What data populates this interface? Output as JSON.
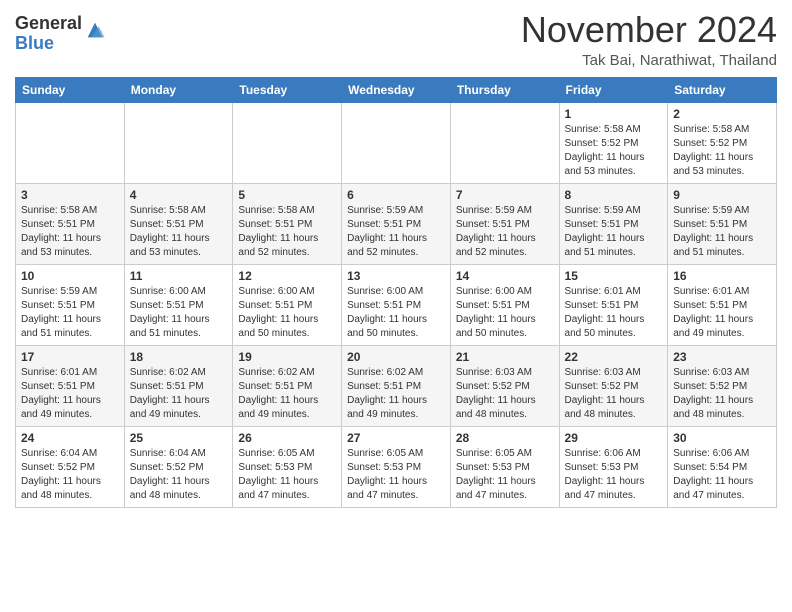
{
  "logo": {
    "general": "General",
    "blue": "Blue"
  },
  "header": {
    "month": "November 2024",
    "location": "Tak Bai, Narathiwat, Thailand"
  },
  "weekdays": [
    "Sunday",
    "Monday",
    "Tuesday",
    "Wednesday",
    "Thursday",
    "Friday",
    "Saturday"
  ],
  "weeks": [
    [
      {
        "day": "",
        "sunrise": "",
        "sunset": "",
        "daylight": ""
      },
      {
        "day": "",
        "sunrise": "",
        "sunset": "",
        "daylight": ""
      },
      {
        "day": "",
        "sunrise": "",
        "sunset": "",
        "daylight": ""
      },
      {
        "day": "",
        "sunrise": "",
        "sunset": "",
        "daylight": ""
      },
      {
        "day": "",
        "sunrise": "",
        "sunset": "",
        "daylight": ""
      },
      {
        "day": "1",
        "sunrise": "Sunrise: 5:58 AM",
        "sunset": "Sunset: 5:52 PM",
        "daylight": "Daylight: 11 hours and 53 minutes."
      },
      {
        "day": "2",
        "sunrise": "Sunrise: 5:58 AM",
        "sunset": "Sunset: 5:52 PM",
        "daylight": "Daylight: 11 hours and 53 minutes."
      }
    ],
    [
      {
        "day": "3",
        "sunrise": "Sunrise: 5:58 AM",
        "sunset": "Sunset: 5:51 PM",
        "daylight": "Daylight: 11 hours and 53 minutes."
      },
      {
        "day": "4",
        "sunrise": "Sunrise: 5:58 AM",
        "sunset": "Sunset: 5:51 PM",
        "daylight": "Daylight: 11 hours and 53 minutes."
      },
      {
        "day": "5",
        "sunrise": "Sunrise: 5:58 AM",
        "sunset": "Sunset: 5:51 PM",
        "daylight": "Daylight: 11 hours and 52 minutes."
      },
      {
        "day": "6",
        "sunrise": "Sunrise: 5:59 AM",
        "sunset": "Sunset: 5:51 PM",
        "daylight": "Daylight: 11 hours and 52 minutes."
      },
      {
        "day": "7",
        "sunrise": "Sunrise: 5:59 AM",
        "sunset": "Sunset: 5:51 PM",
        "daylight": "Daylight: 11 hours and 52 minutes."
      },
      {
        "day": "8",
        "sunrise": "Sunrise: 5:59 AM",
        "sunset": "Sunset: 5:51 PM",
        "daylight": "Daylight: 11 hours and 51 minutes."
      },
      {
        "day": "9",
        "sunrise": "Sunrise: 5:59 AM",
        "sunset": "Sunset: 5:51 PM",
        "daylight": "Daylight: 11 hours and 51 minutes."
      }
    ],
    [
      {
        "day": "10",
        "sunrise": "Sunrise: 5:59 AM",
        "sunset": "Sunset: 5:51 PM",
        "daylight": "Daylight: 11 hours and 51 minutes."
      },
      {
        "day": "11",
        "sunrise": "Sunrise: 6:00 AM",
        "sunset": "Sunset: 5:51 PM",
        "daylight": "Daylight: 11 hours and 51 minutes."
      },
      {
        "day": "12",
        "sunrise": "Sunrise: 6:00 AM",
        "sunset": "Sunset: 5:51 PM",
        "daylight": "Daylight: 11 hours and 50 minutes."
      },
      {
        "day": "13",
        "sunrise": "Sunrise: 6:00 AM",
        "sunset": "Sunset: 5:51 PM",
        "daylight": "Daylight: 11 hours and 50 minutes."
      },
      {
        "day": "14",
        "sunrise": "Sunrise: 6:00 AM",
        "sunset": "Sunset: 5:51 PM",
        "daylight": "Daylight: 11 hours and 50 minutes."
      },
      {
        "day": "15",
        "sunrise": "Sunrise: 6:01 AM",
        "sunset": "Sunset: 5:51 PM",
        "daylight": "Daylight: 11 hours and 50 minutes."
      },
      {
        "day": "16",
        "sunrise": "Sunrise: 6:01 AM",
        "sunset": "Sunset: 5:51 PM",
        "daylight": "Daylight: 11 hours and 49 minutes."
      }
    ],
    [
      {
        "day": "17",
        "sunrise": "Sunrise: 6:01 AM",
        "sunset": "Sunset: 5:51 PM",
        "daylight": "Daylight: 11 hours and 49 minutes."
      },
      {
        "day": "18",
        "sunrise": "Sunrise: 6:02 AM",
        "sunset": "Sunset: 5:51 PM",
        "daylight": "Daylight: 11 hours and 49 minutes."
      },
      {
        "day": "19",
        "sunrise": "Sunrise: 6:02 AM",
        "sunset": "Sunset: 5:51 PM",
        "daylight": "Daylight: 11 hours and 49 minutes."
      },
      {
        "day": "20",
        "sunrise": "Sunrise: 6:02 AM",
        "sunset": "Sunset: 5:51 PM",
        "daylight": "Daylight: 11 hours and 49 minutes."
      },
      {
        "day": "21",
        "sunrise": "Sunrise: 6:03 AM",
        "sunset": "Sunset: 5:52 PM",
        "daylight": "Daylight: 11 hours and 48 minutes."
      },
      {
        "day": "22",
        "sunrise": "Sunrise: 6:03 AM",
        "sunset": "Sunset: 5:52 PM",
        "daylight": "Daylight: 11 hours and 48 minutes."
      },
      {
        "day": "23",
        "sunrise": "Sunrise: 6:03 AM",
        "sunset": "Sunset: 5:52 PM",
        "daylight": "Daylight: 11 hours and 48 minutes."
      }
    ],
    [
      {
        "day": "24",
        "sunrise": "Sunrise: 6:04 AM",
        "sunset": "Sunset: 5:52 PM",
        "daylight": "Daylight: 11 hours and 48 minutes."
      },
      {
        "day": "25",
        "sunrise": "Sunrise: 6:04 AM",
        "sunset": "Sunset: 5:52 PM",
        "daylight": "Daylight: 11 hours and 48 minutes."
      },
      {
        "day": "26",
        "sunrise": "Sunrise: 6:05 AM",
        "sunset": "Sunset: 5:53 PM",
        "daylight": "Daylight: 11 hours and 47 minutes."
      },
      {
        "day": "27",
        "sunrise": "Sunrise: 6:05 AM",
        "sunset": "Sunset: 5:53 PM",
        "daylight": "Daylight: 11 hours and 47 minutes."
      },
      {
        "day": "28",
        "sunrise": "Sunrise: 6:05 AM",
        "sunset": "Sunset: 5:53 PM",
        "daylight": "Daylight: 11 hours and 47 minutes."
      },
      {
        "day": "29",
        "sunrise": "Sunrise: 6:06 AM",
        "sunset": "Sunset: 5:53 PM",
        "daylight": "Daylight: 11 hours and 47 minutes."
      },
      {
        "day": "30",
        "sunrise": "Sunrise: 6:06 AM",
        "sunset": "Sunset: 5:54 PM",
        "daylight": "Daylight: 11 hours and 47 minutes."
      }
    ]
  ]
}
